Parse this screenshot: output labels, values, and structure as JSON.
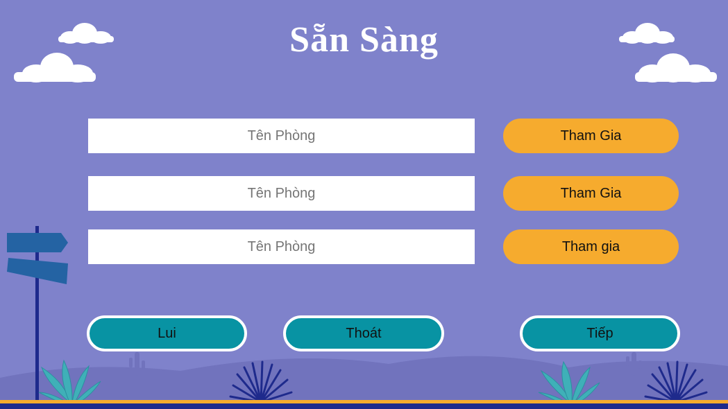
{
  "screen": {
    "title": "Sẵn Sàng"
  },
  "rooms": [
    {
      "name_placeholder": "Tên Phòng",
      "join_label": "Tham Gia"
    },
    {
      "name_placeholder": "Tên Phòng",
      "join_label": "Tham Gia"
    },
    {
      "name_placeholder": "Tên Phòng",
      "join_label": "Tham gia"
    }
  ],
  "navigation": {
    "back_label": "Lui",
    "exit_label": "Thoát",
    "next_label": "Tiếp"
  },
  "colors": {
    "background": "#7f82cb",
    "join_button": "#f6ab2e",
    "nav_button": "#0893a3",
    "ground_stripe": "#f6ab2e",
    "ground_base": "#1e2a8c"
  }
}
